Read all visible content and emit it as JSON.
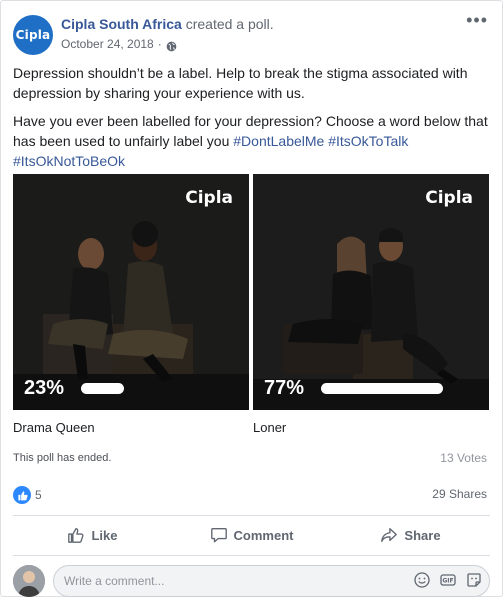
{
  "post": {
    "author": "Cipla South Africa",
    "action": "created a poll.",
    "date": "October 24, 2018",
    "separator": "·",
    "avatar_text": "Cipla",
    "more": "•••"
  },
  "body": {
    "paragraph1": "Depression shouldn’t be a label. Help to break the stigma associated with depression by sharing your experience with us.",
    "paragraph2_text": "Have you ever been labelled for your depression? Choose a word below that has been used to unfairly label you ",
    "hashtags": [
      "#DontLabelMe",
      "#ItsOkToTalk",
      "#ItsOkNotToBeOk"
    ]
  },
  "poll": {
    "options": [
      {
        "label": "Drama Queen",
        "percent_text": "23%",
        "percent": 23,
        "brand": "Cipla"
      },
      {
        "label": "Loner",
        "percent_text": "77%",
        "percent": 77,
        "brand": "Cipla"
      }
    ],
    "status": "This poll has ended.",
    "votes": "13 Votes"
  },
  "engagement": {
    "reaction_count": "5",
    "shares": "29 Shares"
  },
  "actions": {
    "like": "Like",
    "comment": "Comment",
    "share": "Share"
  },
  "comment_box": {
    "placeholder": "Write a comment..."
  },
  "icons": {
    "globe": "globe-icon",
    "like": "thumbs-up-icon",
    "comment": "speech-bubble-icon",
    "share": "share-arrow-icon",
    "emoji": "smiley-icon",
    "gif": "gif-icon",
    "sticker": "sticker-icon"
  },
  "colors": {
    "link": "#385898",
    "brand_blue": "#1f6fc6",
    "like_blue": "#2d88ff"
  }
}
